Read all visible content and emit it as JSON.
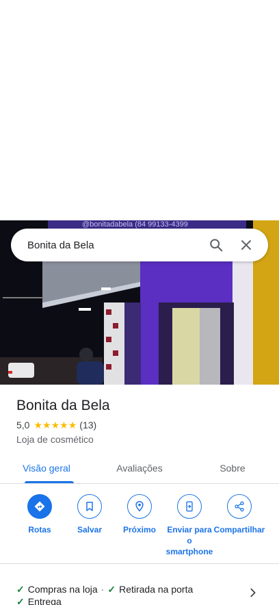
{
  "search": {
    "query": "Bonita da Bela"
  },
  "photo": {
    "sign_text": "@bonitadabela  (84 99133-4399"
  },
  "place": {
    "name": "Bonita da Bela",
    "rating": "5,0",
    "stars": 5,
    "reviews": "(13)",
    "category": "Loja de cosmético"
  },
  "tabs": [
    {
      "label": "Visão geral",
      "active": true
    },
    {
      "label": "Avaliações",
      "active": false
    },
    {
      "label": "Sobre",
      "active": false
    }
  ],
  "actions": [
    {
      "label": "Rotas",
      "icon": "directions-icon"
    },
    {
      "label": "Salvar",
      "icon": "bookmark-icon"
    },
    {
      "label": "Próximo",
      "icon": "nearby-icon"
    },
    {
      "label": "Enviar para o smartphone",
      "icon": "send-to-phone-icon"
    },
    {
      "label": "Compartilhar",
      "icon": "share-icon"
    }
  ],
  "features": {
    "item1": "Compras na loja",
    "item2": "Retirada na porta",
    "item3": "Entrega"
  },
  "colors": {
    "accent": "#1a73e8",
    "star": "#fbbc04",
    "check": "#188038"
  }
}
